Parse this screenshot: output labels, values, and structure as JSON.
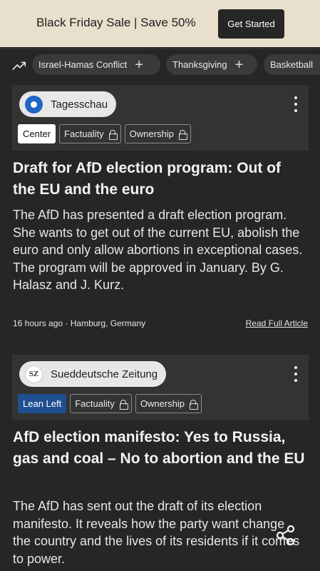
{
  "promo": {
    "text": "Black Friday Sale | Save 50%",
    "button": "Get Started"
  },
  "topics": [
    {
      "label": "Israel-Hamas Conflict"
    },
    {
      "label": "Thanksgiving"
    },
    {
      "label": "Basketball"
    }
  ],
  "articles": [
    {
      "source": "Tagesschau",
      "bias": "Center",
      "factuality": "Factuality",
      "ownership": "Ownership",
      "headline": "Draft for AfD election program: Out of the EU and the euro",
      "summary": "The AfD has presented a draft election program. She wants to get out of the current EU, abolish the euro and only allow abortions in exceptional cases. The program will be approved in January. By G. Halasz and J. Kurz.",
      "time": "16 hours ago",
      "location": "Hamburg, Germany",
      "read_link": "Read Full Article"
    },
    {
      "source": "Sueddeutsche Zeitung",
      "source_logo": "SZ",
      "bias": "Lean Left",
      "factuality": "Factuality",
      "ownership": "Ownership",
      "headline": "AfD election manifesto: Yes to Russia, gas and coal – No to abortion and the EU",
      "summary": "The AfD has sent out the draft of its election manifesto. It reveals how the party want change the country and the lives of its residents if it comes to power."
    }
  ],
  "colors": {
    "center_tag": "#ffffff",
    "lean_left_tag": "#1f4f91",
    "promo_bg": "#e8dfcd"
  },
  "icons": {
    "trending": "trending-up-icon",
    "share": "share-icon",
    "more": "kebab-menu-icon",
    "lock": "lock-icon"
  }
}
